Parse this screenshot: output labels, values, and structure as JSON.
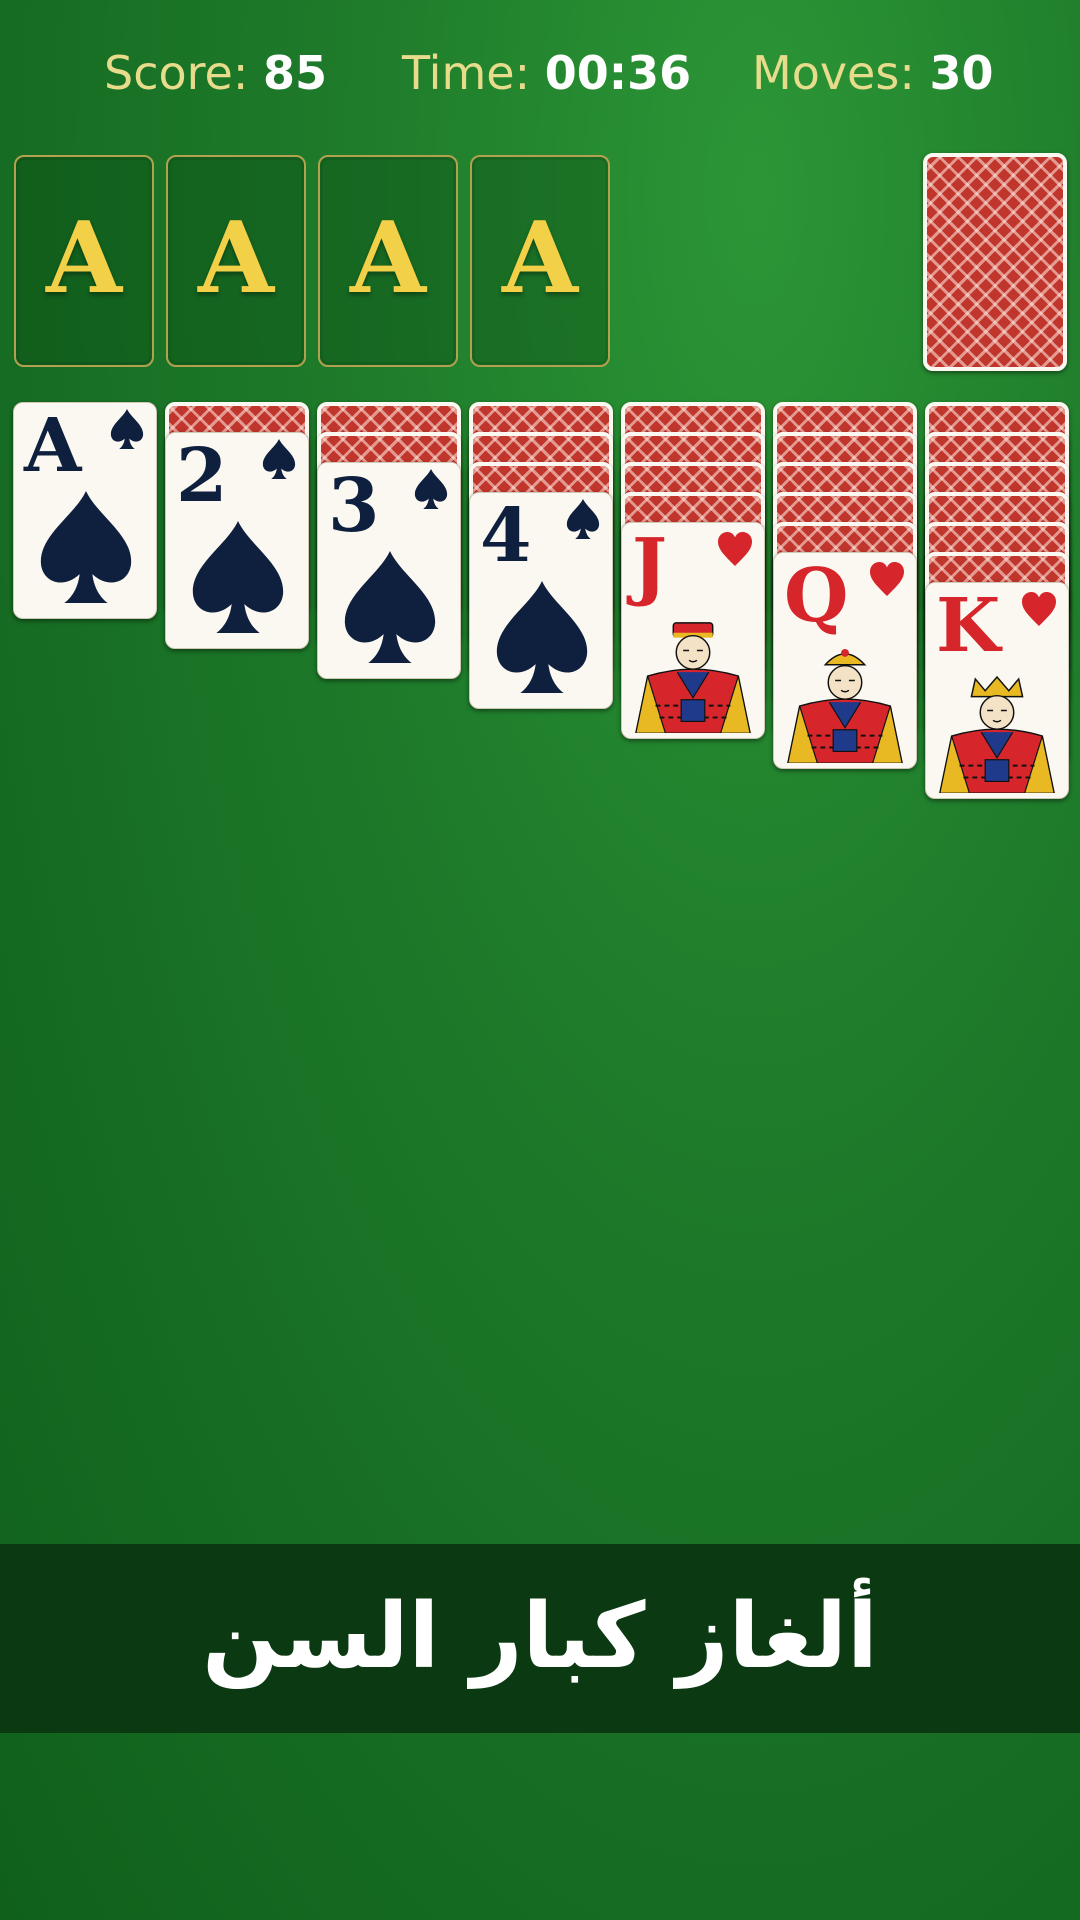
{
  "stats": {
    "score_label": "Score:",
    "score_value": "85",
    "time_label": "Time:",
    "time_value": "00:36",
    "moves_label": "Moves:",
    "moves_value": "30"
  },
  "foundations": [
    "A",
    "A",
    "A",
    "A"
  ],
  "stock": {
    "face_down": true
  },
  "tableau": [
    {
      "face_down_count": 0,
      "top_rank": "A",
      "suit": "spade-icon",
      "color": "#0f1f3e"
    },
    {
      "face_down_count": 1,
      "top_rank": "2",
      "suit": "spade-icon",
      "color": "#0f1f3e"
    },
    {
      "face_down_count": 2,
      "top_rank": "3",
      "suit": "spade-icon",
      "color": "#0f1f3e"
    },
    {
      "face_down_count": 3,
      "top_rank": "4",
      "suit": "spade-icon",
      "color": "#0f1f3e"
    },
    {
      "face_down_count": 4,
      "top_rank": "J",
      "suit": "heart-icon",
      "color": "#d6262b"
    },
    {
      "face_down_count": 5,
      "top_rank": "Q",
      "suit": "heart-icon",
      "color": "#d6262b"
    },
    {
      "face_down_count": 6,
      "top_rank": "K",
      "suit": "heart-icon",
      "color": "#d6262b"
    }
  ],
  "banner": {
    "text": "ألغاز كبار السن"
  },
  "colors": {
    "felt": "#1f7d2b",
    "accent_gold": "#f2d148",
    "label_gold": "#e7dc8c",
    "card_back_red": "#c0352c"
  }
}
